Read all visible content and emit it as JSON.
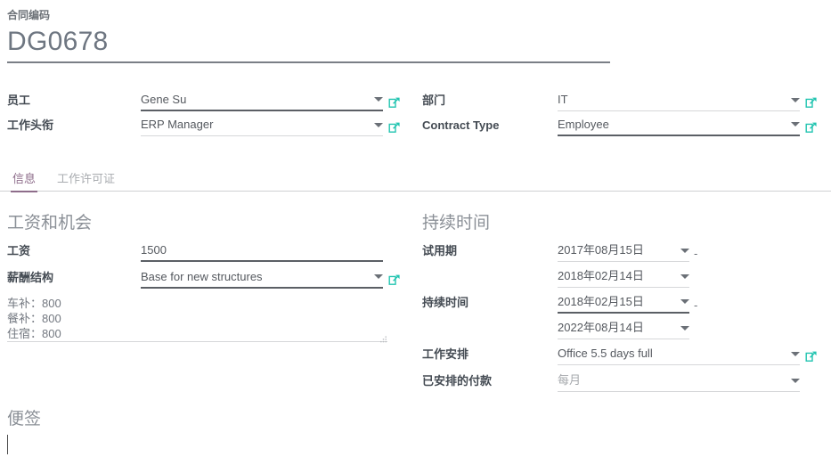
{
  "header": {
    "code_label": "合同编码",
    "code_value": "DG0678"
  },
  "top_form": {
    "rows": [
      {
        "left": {
          "label": "员工",
          "value": "Gene Su",
          "caret": "chevron-down-icon",
          "link": "external-link-icon",
          "emphasis": "dark"
        },
        "right": {
          "label": "部门",
          "value": "IT",
          "caret": "chevron-down-icon",
          "link": "external-link-icon",
          "emphasis": "light"
        }
      },
      {
        "left": {
          "label": "工作头衔",
          "value": "ERP Manager",
          "caret": "chevron-down-icon",
          "link": "external-link-icon",
          "emphasis": "light"
        },
        "right": {
          "label": "Contract Type",
          "value": "Employee",
          "caret": "chevron-down-icon",
          "link": "external-link-icon",
          "emphasis": "dark"
        }
      }
    ]
  },
  "tabs": {
    "items": [
      {
        "label": "信息",
        "active": true
      },
      {
        "label": "工作许可证",
        "active": false
      }
    ],
    "active_color": "#8e6d8b"
  },
  "salary_section": {
    "title": "工资和机会",
    "salary_label": "工资",
    "salary_value": "1500",
    "structure_label": "薪酬结构",
    "structure_value": "Base for new structures",
    "structure_link": "external-link-icon",
    "allowances": [
      "车补：800",
      "餐补：800",
      "住宿：800"
    ]
  },
  "duration_section": {
    "title": "持续时间",
    "trial_label": "试用期",
    "trial_start": "2017年08月15日",
    "trial_end": "2018年02月14日",
    "duration_label": "持续时间",
    "duration_start": "2018年02月15日",
    "duration_end": "2022年08月14日",
    "range_separator": "-",
    "schedule_label": "工作安排",
    "schedule_value": "Office 5.5 days full",
    "schedule_link": "external-link-icon",
    "payment_label": "已安排的付款",
    "payment_value": "每月"
  },
  "notes": {
    "title": "便签",
    "value": ""
  },
  "colors": {
    "accent_teal": "#21c4b0",
    "tab_active": "#8e6d8b",
    "label": "#444b53",
    "value": "#55595f",
    "section_title": "#8b9097",
    "underline_light": "#d6d7d9",
    "underline_dark": "#5b5f65"
  }
}
